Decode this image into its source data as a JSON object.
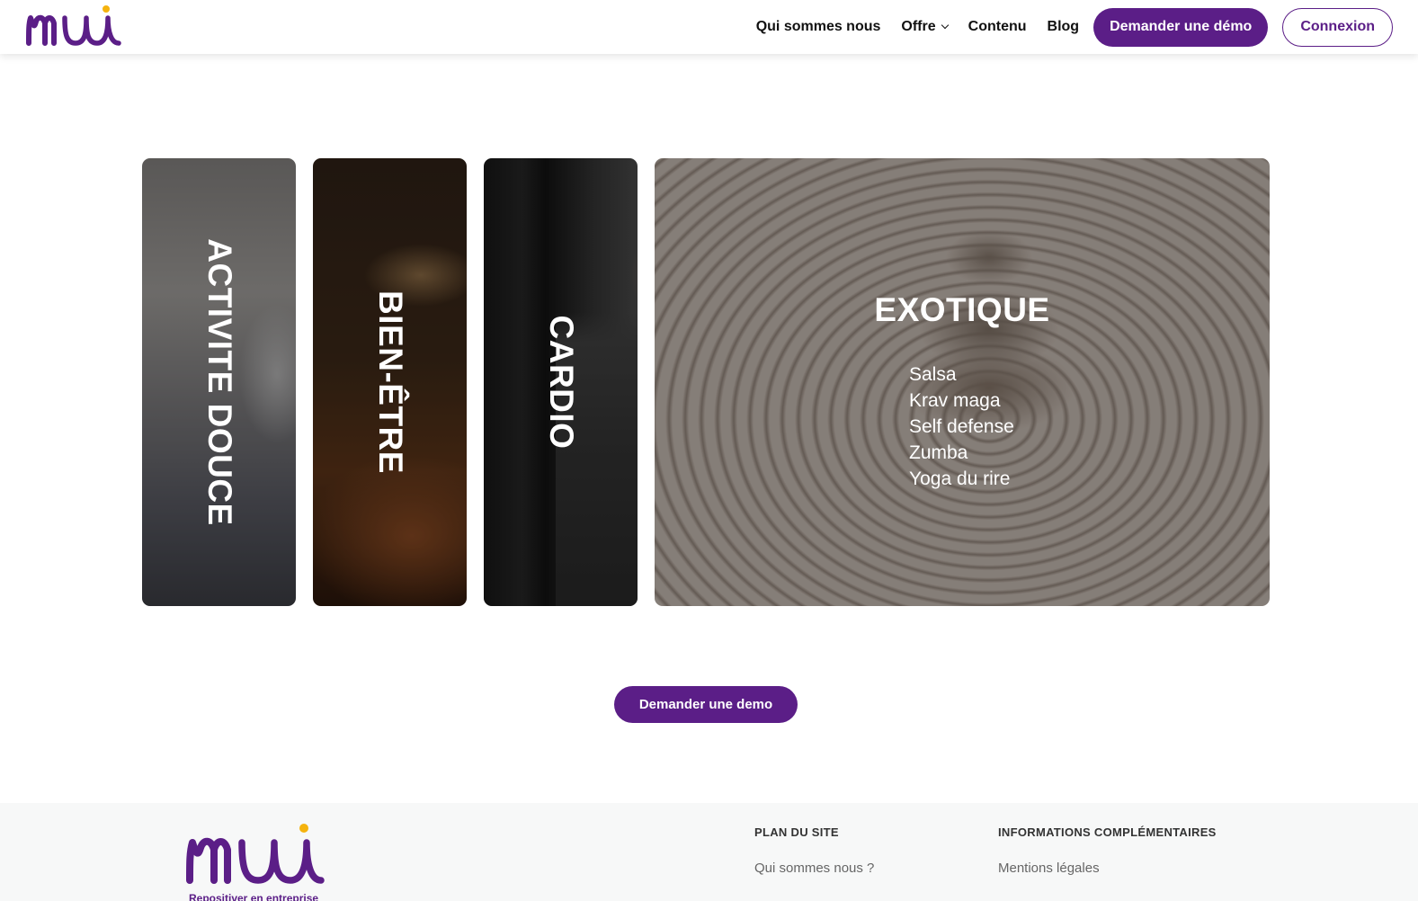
{
  "brand": {
    "logo_text": "mü",
    "primary_color": "#5b1e87",
    "accent_color": "#f5b30e"
  },
  "header": {
    "nav": [
      {
        "label": "Qui sommes nous"
      },
      {
        "label": "Offre",
        "has_dropdown": true
      },
      {
        "label": "Contenu"
      },
      {
        "label": "Blog"
      }
    ],
    "demo_button": "Demander une démo",
    "login_button": "Connexion"
  },
  "cards": [
    {
      "label": "ACTIVITE DOUCE"
    },
    {
      "label": "BIEN-ÊTRE"
    },
    {
      "label": "CARDIO"
    },
    {
      "label": "EXOTIQUE",
      "items": [
        "Salsa",
        "Krav maga",
        "Self defense",
        "Zumba",
        "Yoga du rire"
      ]
    }
  ],
  "cta": {
    "label": "Demander une demo"
  },
  "footer": {
    "tagline": "Repositiver en entreprise",
    "columns": [
      {
        "heading": "PLAN DU SITE",
        "links": [
          "Qui sommes nous ?"
        ]
      },
      {
        "heading": "INFORMATIONS COMPLÉMENTAIRES",
        "links": [
          "Mentions légales"
        ]
      }
    ]
  }
}
